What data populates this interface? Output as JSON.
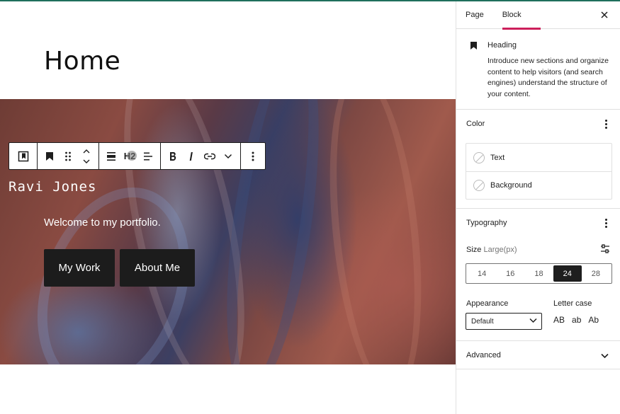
{
  "canvas": {
    "page_title": "Home",
    "cover": {
      "heading": "Ravi Jones",
      "tagline": "Welcome to my portfolio.",
      "buttons": [
        "My Work",
        "About Me"
      ]
    },
    "toolbar": {
      "heading_level": "H2",
      "icons": [
        "select-parent-icon",
        "bookmark-icon",
        "drag-handle-icon",
        "move-up-icon",
        "move-down-icon",
        "align-icon",
        "heading-level-icon",
        "text-align-icon",
        "bold-icon",
        "italic-icon",
        "link-icon",
        "more-rich-text-icon",
        "options-icon"
      ]
    }
  },
  "sidebar": {
    "tabs": [
      "Page",
      "Block"
    ],
    "active_tab": "Block",
    "block": {
      "title": "Heading",
      "description": "Introduce new sections and organize content to help visitors (and search engines) understand the structure of your content."
    },
    "color": {
      "title": "Color",
      "items": [
        "Text",
        "Background"
      ]
    },
    "typography": {
      "title": "Typography",
      "size_label": "Size",
      "size_value": "Large(px)",
      "sizes": [
        "14",
        "16",
        "18",
        "24",
        "28"
      ],
      "selected_size": "24",
      "appearance_label": "Appearance",
      "appearance_value": "Default",
      "letter_case_label": "Letter case",
      "letter_case_options": [
        "AB",
        "ab",
        "Ab"
      ]
    },
    "advanced": {
      "title": "Advanced"
    }
  },
  "colors": {
    "accent_tab": "#cc1f5b",
    "dark": "#1e1e1e",
    "top_accent": "#1f6f5c"
  }
}
